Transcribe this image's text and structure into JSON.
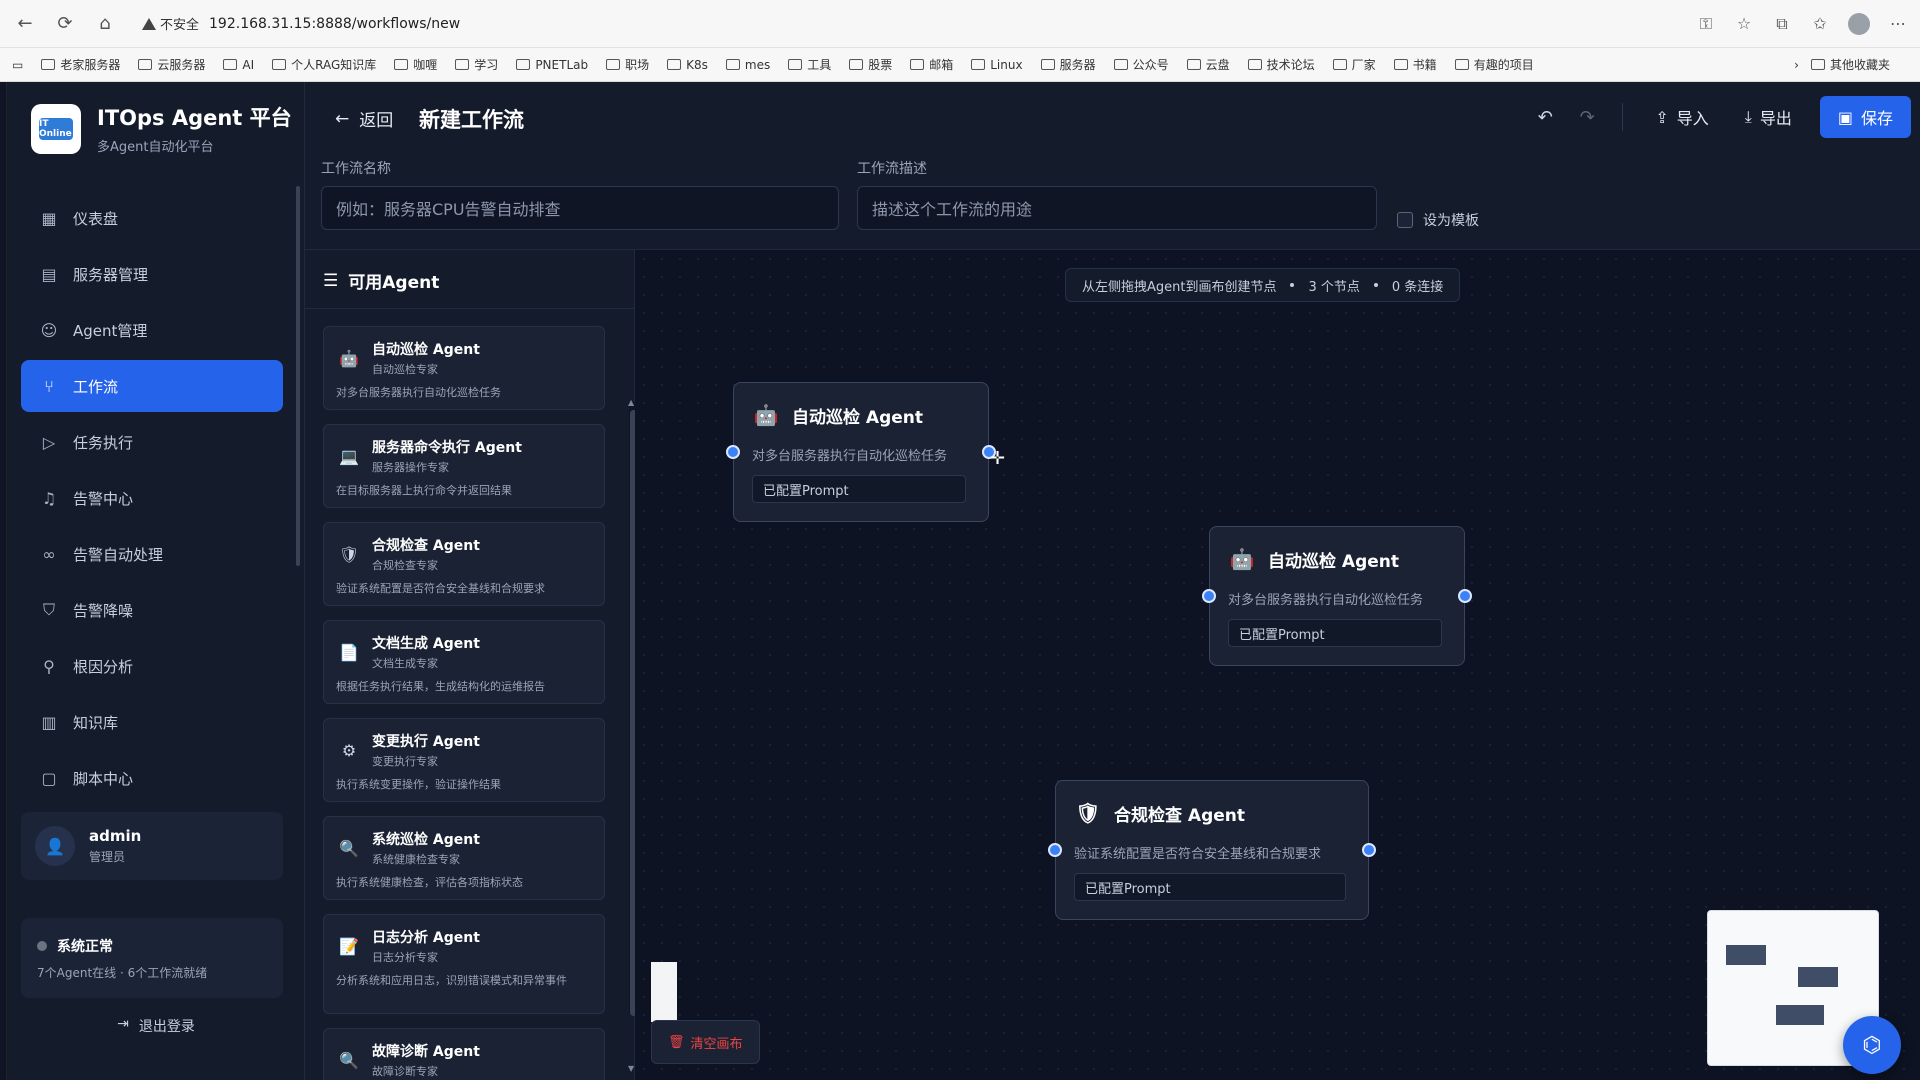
{
  "browser": {
    "security_label": "不安全",
    "url": "192.168.31.15:8888/workflows/new",
    "bookmarks": [
      "老家服务器",
      "云服务器",
      "AI",
      "个人RAG知识库",
      "咖喱",
      "学习",
      "PNETLab",
      "职场",
      "K8s",
      "mes",
      "工具",
      "股票",
      "邮箱",
      "Linux",
      "服务器",
      "公众号",
      "云盘",
      "技术论坛",
      "厂家",
      "书籍",
      "有趣的项目"
    ],
    "other_bookmarks": "其他收藏夹"
  },
  "brand": {
    "title": "ITOps Agent 平台",
    "subtitle": "多Agent自动化平台",
    "logo_text": "IT Online"
  },
  "nav": [
    {
      "label": "仪表盘",
      "icon": "dashboard-icon"
    },
    {
      "label": "服务器管理",
      "icon": "server-icon"
    },
    {
      "label": "Agent管理",
      "icon": "robot-icon"
    },
    {
      "label": "工作流",
      "icon": "workflow-icon",
      "active": true
    },
    {
      "label": "任务执行",
      "icon": "play-icon"
    },
    {
      "label": "告警中心",
      "icon": "bell-icon"
    },
    {
      "label": "告警自动处理",
      "icon": "link-icon"
    },
    {
      "label": "告警降噪",
      "icon": "shield-icon"
    },
    {
      "label": "根因分析",
      "icon": "search-icon"
    },
    {
      "label": "知识库",
      "icon": "book-icon"
    },
    {
      "label": "脚本中心",
      "icon": "file-icon"
    }
  ],
  "user": {
    "name": "admin",
    "role": "管理员"
  },
  "system_status": {
    "title": "系统正常",
    "subtitle": "7个Agent在线 · 6个工作流就绪"
  },
  "logout_label": "退出登录",
  "header": {
    "back_label": "返回",
    "title": "新建工作流",
    "import_label": "导入",
    "export_label": "导出",
    "save_label": "保存",
    "name_label": "工作流名称",
    "name_placeholder": "例如：服务器CPU告警自动排查",
    "desc_label": "工作流描述",
    "desc_placeholder": "描述这个工作流的用途",
    "template_label": "设为模板"
  },
  "agent_panel": {
    "title": "可用Agent",
    "agents": [
      {
        "name": "自动巡检 Agent",
        "role": "自动巡检专家",
        "desc": "对多台服务器执行自动化巡检任务",
        "icon": "robot-icon"
      },
      {
        "name": "服务器命令执行 Agent",
        "role": "服务器操作专家",
        "desc": "在目标服务器上执行命令并返回结果",
        "icon": "laptop-icon"
      },
      {
        "name": "合规检查 Agent",
        "role": "合规检查专家",
        "desc": "验证系统配置是否符合安全基线和合规要求",
        "icon": "shield-icon"
      },
      {
        "name": "文档生成 Agent",
        "role": "文档生成专家",
        "desc": "根据任务执行结果，生成结构化的运维报告",
        "icon": "document-icon"
      },
      {
        "name": "变更执行 Agent",
        "role": "变更执行专家",
        "desc": "执行系统变更操作，验证操作结果",
        "icon": "gear-icon"
      },
      {
        "name": "系统巡检 Agent",
        "role": "系统健康检查专家",
        "desc": "执行系统健康检查，评估各项指标状态",
        "icon": "magnifier-icon"
      },
      {
        "name": "日志分析 Agent",
        "role": "日志分析专家",
        "desc": "分析系统和应用日志，识别错误模式和异常事件",
        "icon": "log-icon"
      },
      {
        "name": "故障诊断 Agent",
        "role": "故障诊断专家",
        "desc": "",
        "icon": "magnifier-icon"
      }
    ]
  },
  "canvas": {
    "hint": "从左侧拖拽Agent到画布创建节点",
    "node_count": "3 个节点",
    "edge_count": "0 条连接",
    "clear_label": "清空画布",
    "nodes": [
      {
        "name": "自动巡检 Agent",
        "desc": "对多台服务器执行自动化巡检任务",
        "prompt": "已配置Prompt",
        "icon": "robot-icon"
      },
      {
        "name": "自动巡检 Agent",
        "desc": "对多台服务器执行自动化巡检任务",
        "prompt": "已配置Prompt",
        "icon": "robot-icon"
      },
      {
        "name": "合规检查 Agent",
        "desc": "验证系统配置是否符合安全基线和合规要求",
        "prompt": "已配置Prompt",
        "icon": "shield-icon"
      }
    ]
  },
  "colors": {
    "accent": "#2563eb",
    "handle": "#3b82f6",
    "danger": "#ef4444"
  }
}
